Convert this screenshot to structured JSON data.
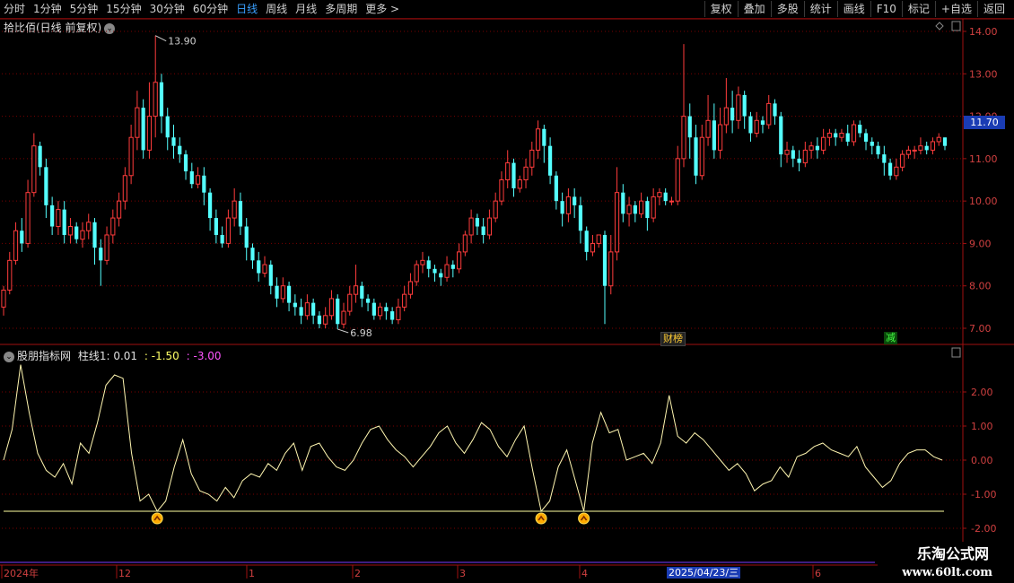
{
  "toolbar": {
    "periods": [
      "分时",
      "1分钟",
      "5分钟",
      "15分钟",
      "30分钟",
      "60分钟",
      "日线",
      "周线",
      "月线",
      "多周期",
      "更多 >"
    ],
    "active_period": "日线",
    "actions": [
      "复权",
      "叠加",
      "多股",
      "统计",
      "画线",
      "F10",
      "标记",
      "+自选",
      "返回"
    ]
  },
  "main_chart": {
    "title": "拾比佰(日线 前复权)",
    "high_label": "13.90",
    "low_label": "6.98",
    "current_price": "11.70",
    "y_ticks": [
      "14.00",
      "13.00",
      "12.00",
      "11.00",
      "10.00",
      "9.00",
      "8.00",
      "7.00"
    ],
    "markers": [
      "财榜",
      "减"
    ],
    "colors": {
      "up": "#ff3c3c",
      "down": "#54ffff",
      "grid": "#7a0000",
      "axis": "#a01010"
    }
  },
  "indicator": {
    "name": "股朋指标网",
    "series_label": "柱线1: 0.01",
    "value_2": ": -1.50",
    "value_3": ": -3.00",
    "y_ticks": [
      "2.00",
      "1.00",
      "0.00",
      "-1.00",
      "-2.00"
    ],
    "line_color": "#fff6b0",
    "threshold_color": "#ffffa0"
  },
  "time_axis": {
    "labels": [
      "2024年",
      "12",
      "1",
      "2",
      "3",
      "4",
      "6"
    ],
    "cursor_date": "2025/04/23/三"
  },
  "watermark": {
    "line1": "乐淘公式网",
    "line2": "www.60lt.com"
  },
  "chart_data": {
    "type": "candlestick",
    "price_range": [
      7.0,
      14.0
    ],
    "indicator_range": [
      -2.0,
      2.0
    ],
    "candles": [
      [
        7.5,
        7.9,
        7.3,
        8.0
      ],
      [
        7.9,
        8.6,
        7.8,
        8.8
      ],
      [
        8.6,
        9.3,
        8.5,
        9.5
      ],
      [
        9.3,
        9.0,
        8.8,
        9.6
      ],
      [
        9.0,
        10.2,
        8.9,
        10.5
      ],
      [
        10.2,
        11.3,
        10.1,
        11.6
      ],
      [
        11.3,
        10.8,
        10.6,
        11.4
      ],
      [
        10.8,
        9.9,
        9.6,
        11.0
      ],
      [
        9.9,
        9.4,
        9.2,
        10.1
      ],
      [
        9.4,
        9.8,
        9.2,
        10.0
      ],
      [
        9.8,
        9.2,
        9.0,
        10.0
      ],
      [
        9.2,
        9.4,
        9.0,
        9.6
      ],
      [
        9.4,
        9.1,
        9.0,
        9.5
      ],
      [
        9.1,
        9.3,
        8.9,
        9.5
      ],
      [
        9.3,
        9.5,
        9.1,
        9.7
      ],
      [
        9.5,
        8.9,
        8.5,
        9.6
      ],
      [
        8.9,
        8.6,
        8.0,
        9.1
      ],
      [
        8.6,
        9.2,
        8.5,
        9.4
      ],
      [
        9.2,
        9.6,
        9.0,
        9.8
      ],
      [
        9.6,
        10.0,
        9.4,
        10.2
      ],
      [
        10.0,
        10.6,
        9.8,
        10.8
      ],
      [
        10.6,
        11.5,
        10.4,
        11.8
      ],
      [
        11.5,
        12.2,
        11.2,
        12.6
      ],
      [
        12.2,
        11.2,
        11.0,
        12.4
      ],
      [
        11.2,
        12.0,
        11.0,
        12.8
      ],
      [
        12.0,
        12.8,
        11.5,
        13.9
      ],
      [
        12.8,
        12.0,
        11.6,
        13.0
      ],
      [
        12.0,
        11.5,
        11.2,
        12.2
      ],
      [
        11.5,
        11.3,
        11.0,
        11.8
      ],
      [
        11.3,
        11.1,
        10.9,
        11.5
      ],
      [
        11.1,
        10.7,
        10.5,
        11.2
      ],
      [
        10.7,
        10.4,
        10.3,
        10.9
      ],
      [
        10.4,
        10.6,
        10.3,
        10.8
      ],
      [
        10.6,
        10.2,
        9.9,
        10.8
      ],
      [
        10.2,
        9.6,
        9.3,
        10.3
      ],
      [
        9.6,
        9.2,
        9.0,
        9.8
      ],
      [
        9.2,
        9.0,
        8.9,
        9.4
      ],
      [
        9.0,
        9.6,
        8.9,
        9.8
      ],
      [
        9.6,
        10.0,
        9.4,
        10.3
      ],
      [
        10.0,
        9.4,
        9.2,
        10.2
      ],
      [
        9.4,
        8.9,
        8.6,
        9.6
      ],
      [
        8.9,
        8.6,
        8.4,
        9.0
      ],
      [
        8.6,
        8.3,
        8.1,
        8.8
      ],
      [
        8.3,
        8.5,
        8.2,
        8.7
      ],
      [
        8.5,
        8.0,
        7.8,
        8.6
      ],
      [
        8.0,
        7.7,
        7.5,
        8.2
      ],
      [
        7.7,
        8.0,
        7.6,
        8.2
      ],
      [
        8.0,
        7.6,
        7.4,
        8.1
      ],
      [
        7.6,
        7.5,
        7.3,
        7.8
      ],
      [
        7.5,
        7.3,
        7.1,
        7.7
      ],
      [
        7.3,
        7.6,
        7.2,
        7.8
      ],
      [
        7.6,
        7.3,
        7.1,
        7.7
      ],
      [
        7.3,
        7.1,
        7.0,
        7.4
      ],
      [
        7.1,
        7.3,
        7.0,
        7.5
      ],
      [
        7.3,
        7.7,
        7.2,
        7.9
      ],
      [
        7.7,
        7.1,
        6.98,
        7.8
      ],
      [
        7.1,
        7.4,
        7.0,
        7.6
      ],
      [
        7.4,
        7.8,
        7.3,
        8.0
      ],
      [
        7.8,
        8.0,
        7.6,
        8.5
      ],
      [
        8.0,
        7.7,
        7.5,
        8.1
      ],
      [
        7.7,
        7.6,
        7.4,
        7.8
      ],
      [
        7.6,
        7.3,
        7.2,
        7.7
      ],
      [
        7.3,
        7.5,
        7.2,
        7.6
      ],
      [
        7.5,
        7.4,
        7.2,
        7.6
      ],
      [
        7.4,
        7.2,
        7.1,
        7.5
      ],
      [
        7.2,
        7.5,
        7.1,
        7.7
      ],
      [
        7.5,
        7.8,
        7.4,
        8.0
      ],
      [
        7.8,
        8.1,
        7.7,
        8.3
      ],
      [
        8.1,
        8.5,
        8.0,
        8.6
      ],
      [
        8.5,
        8.6,
        8.3,
        8.8
      ],
      [
        8.6,
        8.4,
        8.2,
        8.7
      ],
      [
        8.4,
        8.3,
        8.1,
        8.5
      ],
      [
        8.3,
        8.2,
        8.0,
        8.4
      ],
      [
        8.2,
        8.5,
        8.1,
        8.7
      ],
      [
        8.5,
        8.4,
        8.2,
        8.6
      ],
      [
        8.4,
        8.8,
        8.3,
        9.0
      ],
      [
        8.8,
        9.2,
        8.7,
        9.3
      ],
      [
        9.2,
        9.6,
        9.0,
        9.8
      ],
      [
        9.6,
        9.4,
        9.2,
        9.7
      ],
      [
        9.4,
        9.2,
        9.0,
        9.6
      ],
      [
        9.2,
        9.6,
        9.1,
        9.8
      ],
      [
        9.6,
        10.0,
        9.5,
        10.2
      ],
      [
        10.0,
        10.5,
        9.9,
        10.7
      ],
      [
        10.5,
        10.9,
        10.3,
        11.2
      ],
      [
        10.9,
        10.3,
        10.1,
        11.0
      ],
      [
        10.3,
        10.5,
        10.2,
        10.6
      ],
      [
        10.5,
        10.8,
        10.3,
        11.0
      ],
      [
        10.8,
        11.2,
        10.6,
        11.4
      ],
      [
        11.2,
        11.7,
        11.0,
        11.9
      ],
      [
        11.7,
        11.3,
        10.9,
        11.8
      ],
      [
        11.3,
        10.6,
        10.4,
        11.5
      ],
      [
        10.6,
        10.0,
        9.8,
        10.7
      ],
      [
        10.0,
        9.7,
        9.4,
        10.2
      ],
      [
        9.7,
        10.1,
        9.5,
        10.3
      ],
      [
        10.1,
        9.9,
        9.6,
        10.3
      ],
      [
        9.9,
        9.3,
        9.0,
        10.1
      ],
      [
        9.3,
        8.8,
        8.6,
        9.4
      ],
      [
        8.8,
        9.0,
        8.7,
        9.2
      ],
      [
        9.0,
        9.2,
        8.9,
        9.2
      ],
      [
        9.2,
        8.0,
        7.1,
        9.3
      ],
      [
        8.0,
        8.8,
        7.8,
        9.2
      ],
      [
        8.8,
        10.2,
        8.6,
        10.8
      ],
      [
        10.2,
        9.7,
        9.5,
        10.4
      ],
      [
        9.7,
        9.9,
        9.4,
        10.1
      ],
      [
        9.9,
        9.7,
        9.5,
        10.0
      ],
      [
        9.7,
        10.0,
        9.6,
        10.2
      ],
      [
        10.0,
        9.6,
        9.3,
        10.1
      ],
      [
        9.6,
        10.1,
        9.5,
        10.3
      ],
      [
        10.1,
        10.2,
        9.9,
        10.3
      ],
      [
        10.2,
        10.0,
        9.9,
        10.3
      ],
      [
        10.0,
        10.0,
        9.9,
        10.1
      ],
      [
        10.0,
        11.0,
        9.9,
        11.3
      ],
      [
        11.0,
        12.0,
        10.8,
        13.7
      ],
      [
        12.0,
        11.5,
        11.0,
        12.3
      ],
      [
        11.5,
        10.6,
        10.4,
        11.8
      ],
      [
        10.6,
        11.5,
        10.5,
        11.8
      ],
      [
        11.5,
        11.9,
        11.3,
        12.5
      ],
      [
        11.9,
        11.2,
        11.0,
        12.3
      ],
      [
        11.2,
        11.8,
        11.0,
        12.2
      ],
      [
        11.8,
        12.2,
        11.6,
        12.9
      ],
      [
        12.2,
        11.9,
        11.6,
        12.6
      ],
      [
        11.9,
        12.5,
        11.7,
        12.7
      ],
      [
        12.5,
        12.0,
        11.7,
        12.6
      ],
      [
        12.0,
        11.6,
        11.4,
        12.1
      ],
      [
        11.6,
        11.9,
        11.5,
        12.1
      ],
      [
        11.9,
        11.8,
        11.6,
        12.0
      ],
      [
        11.8,
        12.3,
        11.7,
        12.5
      ],
      [
        12.3,
        12.0,
        11.8,
        12.4
      ],
      [
        12.0,
        11.1,
        10.8,
        12.1
      ],
      [
        11.1,
        11.2,
        10.9,
        11.4
      ],
      [
        11.2,
        11.0,
        10.8,
        11.3
      ],
      [
        11.0,
        10.9,
        10.7,
        11.2
      ],
      [
        10.9,
        11.2,
        10.8,
        11.4
      ],
      [
        11.2,
        11.3,
        11.0,
        11.4
      ],
      [
        11.3,
        11.2,
        11.0,
        11.5
      ],
      [
        11.2,
        11.5,
        11.1,
        11.7
      ],
      [
        11.5,
        11.6,
        11.3,
        11.7
      ],
      [
        11.6,
        11.5,
        11.3,
        11.7
      ],
      [
        11.5,
        11.6,
        11.4,
        11.7
      ],
      [
        11.6,
        11.4,
        11.3,
        11.8
      ],
      [
        11.4,
        11.8,
        11.3,
        11.9
      ],
      [
        11.8,
        11.6,
        11.5,
        11.9
      ],
      [
        11.6,
        11.4,
        11.2,
        11.7
      ],
      [
        11.4,
        11.3,
        11.1,
        11.5
      ],
      [
        11.3,
        11.1,
        11.0,
        11.4
      ],
      [
        11.1,
        10.9,
        10.6,
        11.3
      ],
      [
        10.9,
        10.6,
        10.5,
        11.0
      ],
      [
        10.6,
        10.8,
        10.5,
        11.0
      ],
      [
        10.8,
        11.1,
        10.7,
        11.2
      ],
      [
        11.1,
        11.2,
        11.0,
        11.3
      ],
      [
        11.2,
        11.2,
        11.0,
        11.3
      ],
      [
        11.2,
        11.3,
        11.1,
        11.5
      ],
      [
        11.3,
        11.2,
        11.1,
        11.4
      ],
      [
        11.2,
        11.4,
        11.1,
        11.5
      ],
      [
        11.4,
        11.5,
        11.3,
        11.6
      ],
      [
        11.5,
        11.3,
        11.2,
        11.5
      ]
    ],
    "indicator_values": [
      0.0,
      0.9,
      2.8,
      1.4,
      0.2,
      -0.3,
      -0.5,
      -0.1,
      -0.7,
      0.5,
      0.2,
      1.1,
      2.2,
      2.5,
      2.4,
      0.2,
      -1.2,
      -1.0,
      -1.5,
      -1.2,
      -0.2,
      0.6,
      -0.4,
      -0.9,
      -1.0,
      -1.2,
      -0.8,
      -1.1,
      -0.6,
      -0.4,
      -0.5,
      -0.1,
      -0.3,
      0.2,
      0.5,
      -0.3,
      0.4,
      0.5,
      0.1,
      -0.2,
      -0.3,
      0.0,
      0.5,
      0.9,
      1.0,
      0.6,
      0.3,
      0.1,
      -0.2,
      0.1,
      0.4,
      0.8,
      1.0,
      0.5,
      0.2,
      0.6,
      1.1,
      0.9,
      0.4,
      0.1,
      0.6,
      1.0,
      -0.3,
      -1.5,
      -1.2,
      -0.2,
      0.3,
      -0.6,
      -1.5,
      0.5,
      1.4,
      0.8,
      0.9,
      0.0,
      0.1,
      0.2,
      -0.1,
      0.5,
      1.9,
      0.7,
      0.5,
      0.8,
      0.6,
      0.3,
      0.0,
      -0.3,
      -0.1,
      -0.4,
      -0.9,
      -0.7,
      -0.6,
      -0.2,
      -0.5,
      0.1,
      0.2,
      0.4,
      0.5,
      0.3,
      0.2,
      0.1,
      0.4,
      -0.2,
      -0.5,
      -0.8,
      -0.6,
      -0.1,
      0.2,
      0.3,
      0.3,
      0.1,
      0.0
    ]
  }
}
